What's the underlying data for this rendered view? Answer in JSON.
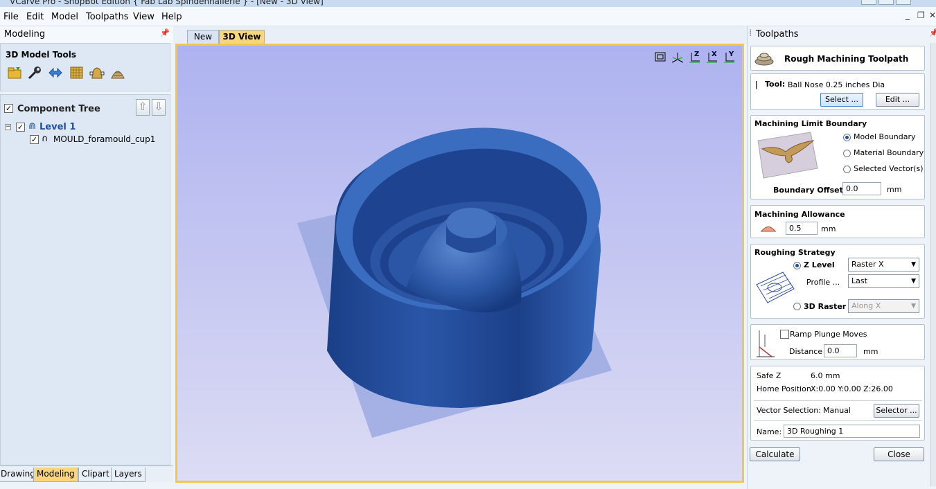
{
  "window": {
    "title": "VCarve Pro - ShopBot Edition { Fab Lab Spindenhallerie } - [New - 3D View]"
  },
  "menu": [
    "File",
    "Edit",
    "Model",
    "Toolpaths",
    "View",
    "Help"
  ],
  "left_panel": {
    "header": "Modeling",
    "tools_title": "3D Model Tools",
    "tools_icons": [
      "import-model-icon",
      "wrench-icon",
      "transform-arrows-icon",
      "texture-icon",
      "distort-icon",
      "mould-dome-icon"
    ],
    "tree_title": "Component Tree",
    "tree": [
      {
        "label": "Level 1",
        "checked": true,
        "level": 0
      },
      {
        "label": "MOULD_foramould_cup1",
        "checked": true,
        "level": 1
      }
    ],
    "bottom_tabs": [
      "Drawing",
      "Modeling",
      "Clipart",
      "Layers"
    ],
    "active_bottom_tab": "Modeling"
  },
  "view": {
    "tabs": [
      "New",
      "3D View"
    ],
    "active_tab": "3D View",
    "view_icons": [
      "fit-view-icon",
      "iso-view-icon",
      "z-axis-view-icon",
      "x-axis-view-icon",
      "y-axis-view-icon"
    ],
    "view_icon_labels": [
      "",
      "",
      "Z",
      "X",
      "Y"
    ]
  },
  "right_panel": {
    "header": "Toolpaths",
    "title": "Rough Machining Toolpath",
    "tool": {
      "label": "Tool:",
      "value": "Ball Nose 0.25 inches Dia",
      "select_btn": "Select ...",
      "edit_btn": "Edit ..."
    },
    "boundary": {
      "title": "Machining Limit Boundary",
      "options": [
        "Model Boundary",
        "Material Boundary",
        "Selected Vector(s)"
      ],
      "selected": "Model Boundary",
      "offset_label": "Boundary Offset",
      "offset_value": "0.0",
      "offset_unit": "mm"
    },
    "allowance": {
      "title": "Machining Allowance",
      "value": "0.5",
      "unit": "mm"
    },
    "strategy": {
      "title": "Roughing Strategy",
      "zlevel_label": "Z Level",
      "zlevel_value": "Raster X",
      "profile_label": "Profile ...",
      "profile_value": "Last",
      "raster_label": "3D Raster",
      "raster_value": "Along X",
      "selected": "Z Level"
    },
    "ramp": {
      "label": "Ramp Plunge Moves",
      "distance_label": "Distance",
      "distance_value": "0.0",
      "unit": "mm"
    },
    "safe_z": {
      "label": "Safe Z",
      "value": "6.0 mm"
    },
    "home": {
      "label": "Home Position",
      "value": "X:0.00 Y:0.00 Z:26.00"
    },
    "vector_sel": {
      "label": "Vector Selection:",
      "value": "Manual",
      "button": "Selector ..."
    },
    "name": {
      "label": "Name:",
      "value": "3D Roughing 1"
    },
    "calculate": "Calculate",
    "close": "Close"
  },
  "colors": {
    "accent_tab": "#f7d77a",
    "viewport_top": "#aeb2ef",
    "model": "#2e5aa8"
  }
}
